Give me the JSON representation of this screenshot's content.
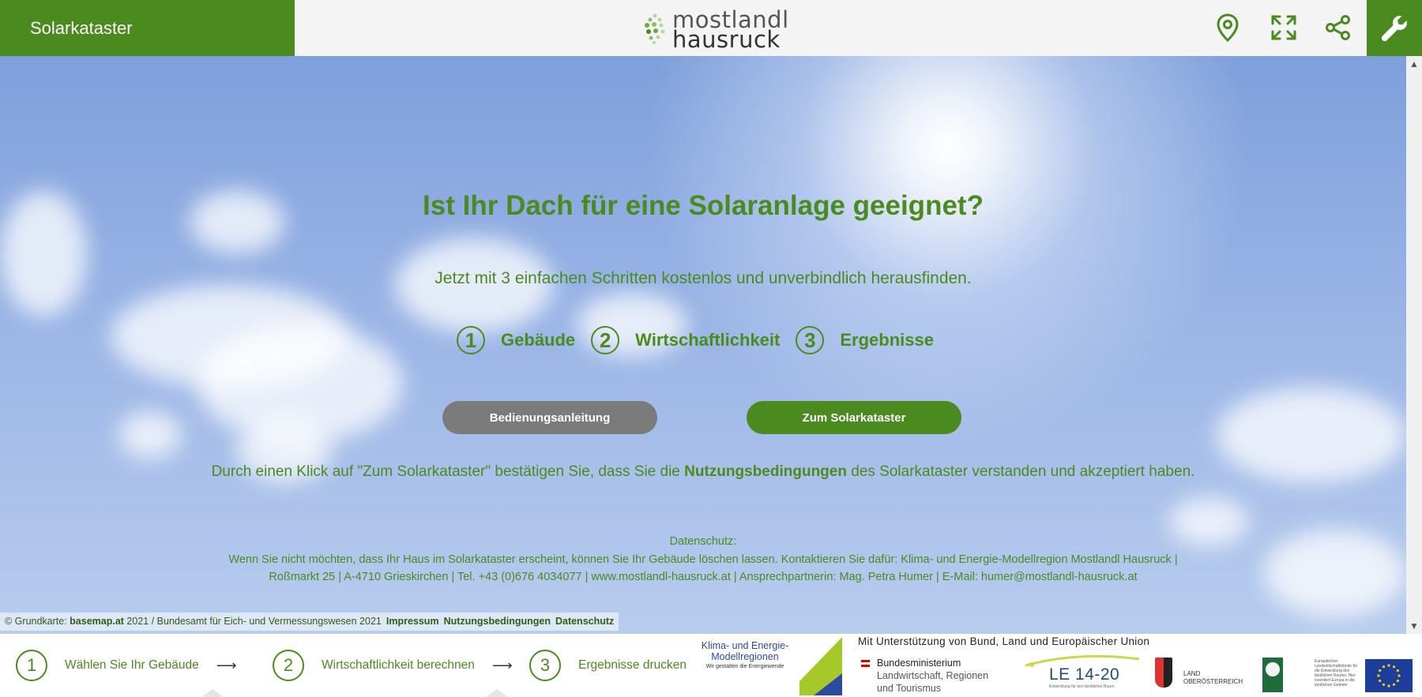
{
  "header": {
    "app_title": "Solarkataster",
    "logo_line1": "mostlandl",
    "logo_line2": "hausruck",
    "icons": [
      "location-pin-icon",
      "fullscreen-icon",
      "share-icon",
      "wrench-icon"
    ]
  },
  "hero": {
    "title": "Ist Ihr Dach für eine Solaranlage geeignet?",
    "subtitle": "Jetzt mit 3 einfachen Schritten kostenlos und unverbindlich herausfinden.",
    "steps": [
      {
        "number": "1",
        "label": "Gebäude"
      },
      {
        "number": "2",
        "label": "Wirtschaftlichkeit"
      },
      {
        "number": "3",
        "label": "Ergebnisse"
      }
    ],
    "button_manual": "Bedienungsanleitung",
    "button_start": "Zum Solarkataster",
    "consent_prefix": "Durch einen Klick auf \"Zum Solarkataster\" bestätigen Sie, dass Sie die ",
    "consent_link": "Nutzungsbedingungen",
    "consent_suffix": " des Solarkataster verstanden und akzeptiert haben.",
    "privacy_heading": "Datenschutz:",
    "privacy_line1": "Wenn Sie nicht möchten, dass Ihr Haus im Solarkataster erscheint, können Sie Ihr Gebäude löschen lassen. Kontaktieren Sie dafür: Klima- und Energie-Modellregion Mostlandl Hausruck |",
    "privacy_line2": "Roßmarkt 25 | A-4710 Grieskirchen | Tel. +43 (0)676 4034077 | www.mostlandl-hausruck.at | Ansprechpartnerin: Mag. Petra Humer | E-Mail: humer@mostlandl-hausruck.at"
  },
  "copyright": {
    "prefix": "© Grundkarte: ",
    "basemap": "basemap.at",
    "suffix": " 2021 / Bundesamt für Eich- und Vermessungswesen 2021",
    "links": [
      "Impressum",
      "Nutzungsbedingungen",
      "Datenschutz"
    ]
  },
  "footer": {
    "steps": [
      {
        "number": "1",
        "label": "Wählen Sie Ihr Gebäude"
      },
      {
        "number": "2",
        "label": "Wirtschaftlichkeit berechnen"
      },
      {
        "number": "3",
        "label": "Ergebnisse drucken"
      }
    ],
    "arrow": "⟶",
    "kem_line1": "Klima- und Energie-",
    "kem_line2": "Modellregionen",
    "kem_tagline": "Wir gestalten die Energiewende",
    "support_text": "Mit Unterstützung von Bund, Land und Europäischer Union",
    "ministry_line1": "Bundesministerium",
    "ministry_line2": "Landwirtschaft, Regionen",
    "ministry_line3": "und Tourismus",
    "le_text": "LE 14-20",
    "le_sub": "Entwicklung für den ländlichen Raum",
    "ooe_line1": "LAND",
    "ooe_line2": "OBERÖSTERREICH",
    "eu_text": "Europäischer Landwirtschaftsfonds für die Entwicklung des ländlichen Raums: Hier investiert Europa in die ländlichen Gebiete"
  },
  "colors": {
    "brand_green": "#4b8a1f",
    "button_grey": "#7b7b7b"
  }
}
